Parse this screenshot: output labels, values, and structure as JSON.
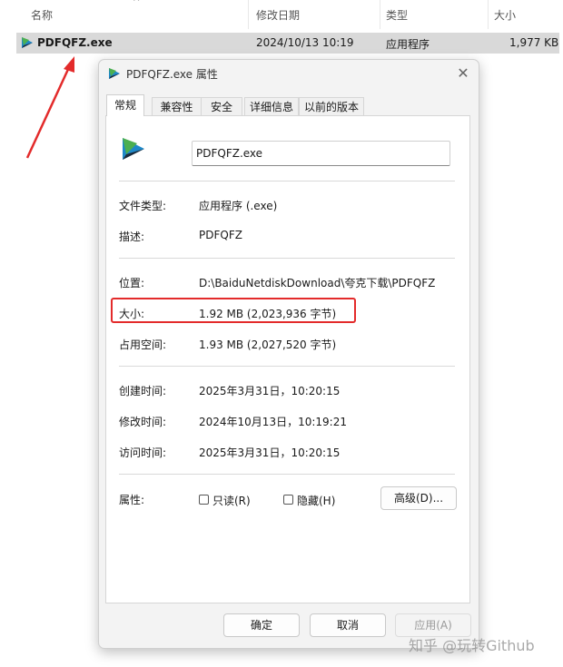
{
  "explorer": {
    "columns": [
      "名称",
      "修改日期",
      "类型",
      "大小"
    ],
    "file": {
      "name": "PDFQFZ.exe",
      "modified": "2024/10/13 10:19",
      "type": "应用程序",
      "size": "1,977 KB"
    }
  },
  "dialog": {
    "title": "PDFQFZ.exe 属性",
    "tabs": [
      "常规",
      "兼容性",
      "安全",
      "详细信息",
      "以前的版本"
    ],
    "filename": "PDFQFZ.exe",
    "fields": {
      "file_type_label": "文件类型:",
      "file_type_value": "应用程序 (.exe)",
      "desc_label": "描述:",
      "desc_value": "PDFQFZ",
      "location_label": "位置:",
      "location_value": "D:\\BaiduNetdiskDownload\\夸克下载\\PDFQFZ",
      "size_label": "大小:",
      "size_value": "1.92 MB (2,023,936 字节)",
      "disk_size_label": "占用空间:",
      "disk_size_value": "1.93 MB (2,027,520 字节)",
      "created_label": "创建时间:",
      "created_value": "2025年3月31日，10:20:15",
      "modified_label": "修改时间:",
      "modified_value": "2024年10月13日，10:19:21",
      "accessed_label": "访问时间:",
      "accessed_value": "2025年3月31日，10:20:15",
      "attributes_label": "属性:",
      "readonly_label": "只读(R)",
      "hidden_label": "隐藏(H)",
      "advanced_label": "高级(D)..."
    },
    "buttons": {
      "ok": "确定",
      "cancel": "取消",
      "apply": "应用(A)"
    }
  },
  "watermark": "知乎 @玩转Github",
  "colors": {
    "highlight": "#e32b2b",
    "selected_row": "#d9d9d9"
  }
}
